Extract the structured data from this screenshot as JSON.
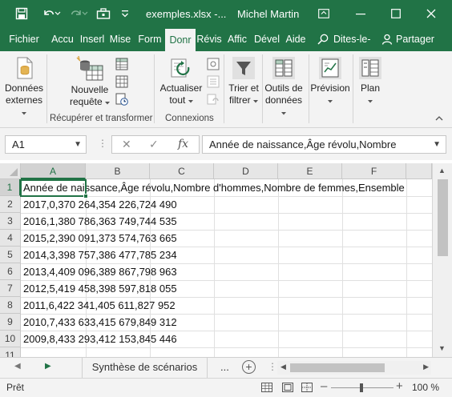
{
  "window": {
    "title": "exemples.xlsx  -...",
    "user": "Michel Martin"
  },
  "tabs": [
    {
      "label": "Fichier"
    },
    {
      "label": "Accu"
    },
    {
      "label": "Inserl"
    },
    {
      "label": "Mise"
    },
    {
      "label": "Form"
    },
    {
      "label": "Donr"
    },
    {
      "label": "Révis"
    },
    {
      "label": "Affic"
    },
    {
      "label": "Dével"
    },
    {
      "label": "Aide"
    }
  ],
  "tell_me": "Dites-le-",
  "share": "Partager",
  "ribbon": {
    "get_data": {
      "line1": "Données",
      "line2": "externes"
    },
    "new_query": {
      "line1": "Nouvelle",
      "line2": "requête"
    },
    "group_get": "Récupérer et transformer",
    "refresh": {
      "line1": "Actualiser",
      "line2": "tout"
    },
    "group_conn": "Connexions",
    "sort": {
      "line1": "Trier et",
      "line2": "filtrer"
    },
    "data_tools": {
      "line1": "Outils de",
      "line2": "données"
    },
    "forecast": {
      "line1": "Prévision"
    },
    "outline": {
      "line1": "Plan"
    }
  },
  "formula_bar": {
    "name_box": "A1",
    "fx": "fx",
    "formula": "Année de naissance,Âge révolu,Nombre"
  },
  "grid": {
    "columns": [
      "A",
      "B",
      "C",
      "D",
      "E",
      "F"
    ],
    "rows": [
      {
        "num": "1",
        "text": "Année de naissance,Âge révolu,Nombre d'hommes,Nombre de femmes,Ensemble"
      },
      {
        "num": "2",
        "text": "2017,0,370 264,354 226,724 490"
      },
      {
        "num": "3",
        "text": "2016,1,380 786,363 749,744 535"
      },
      {
        "num": "4",
        "text": "2015,2,390 091,373 574,763 665"
      },
      {
        "num": "5",
        "text": "2014,3,398 757,386 477,785 234"
      },
      {
        "num": "6",
        "text": "2013,4,409 096,389 867,798 963"
      },
      {
        "num": "7",
        "text": "2012,5,419 458,398 597,818 055"
      },
      {
        "num": "8",
        "text": "2011,6,422 341,405 611,827 952"
      },
      {
        "num": "9",
        "text": "2010,7,433 633,415 679,849 312"
      },
      {
        "num": "10",
        "text": "2009,8,433 293,412 153,845 446"
      },
      {
        "num": "11",
        "text": ""
      }
    ]
  },
  "sheets": {
    "active": "Synthèse de scénarios",
    "more": "..."
  },
  "status": {
    "ready": "Prêt",
    "zoom": "100 %"
  }
}
